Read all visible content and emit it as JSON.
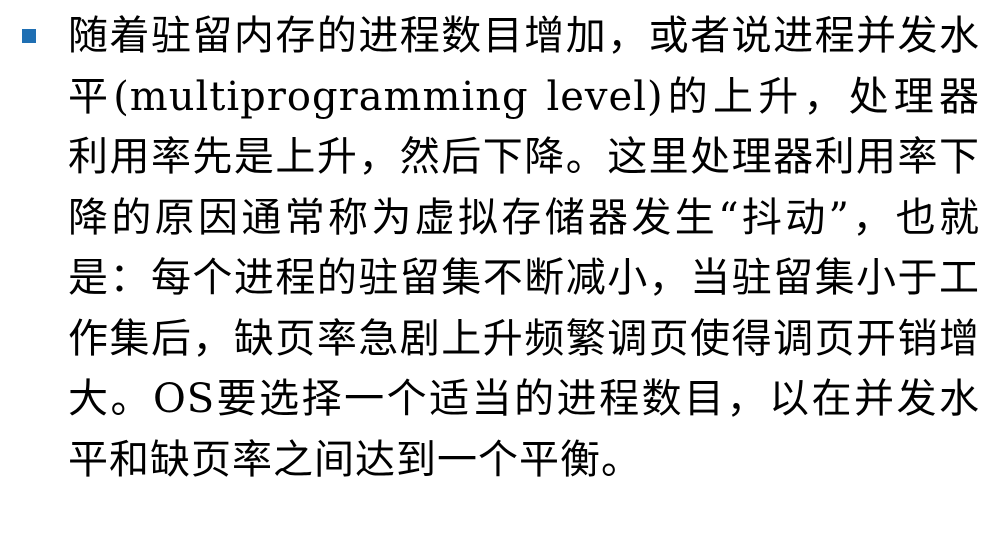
{
  "slide": {
    "bullet_color": "#1f6fb3",
    "paragraph": "随着驻留内存的进程数目增加，或者说进程并发水平(multiprogramming level)的上升，处理器利用率先是上升，然后下降。这里处理器利用率下降的原因通常称为虚拟存储器发生“抖动”，也就是：每个进程的驻留集不断减小，当驻留集小于工作集后，缺页率急剧上升频繁调页使得调页开销增大。OS要选择一个适当的进程数目，以在并发水平和缺页率之间达到一个平衡。"
  }
}
